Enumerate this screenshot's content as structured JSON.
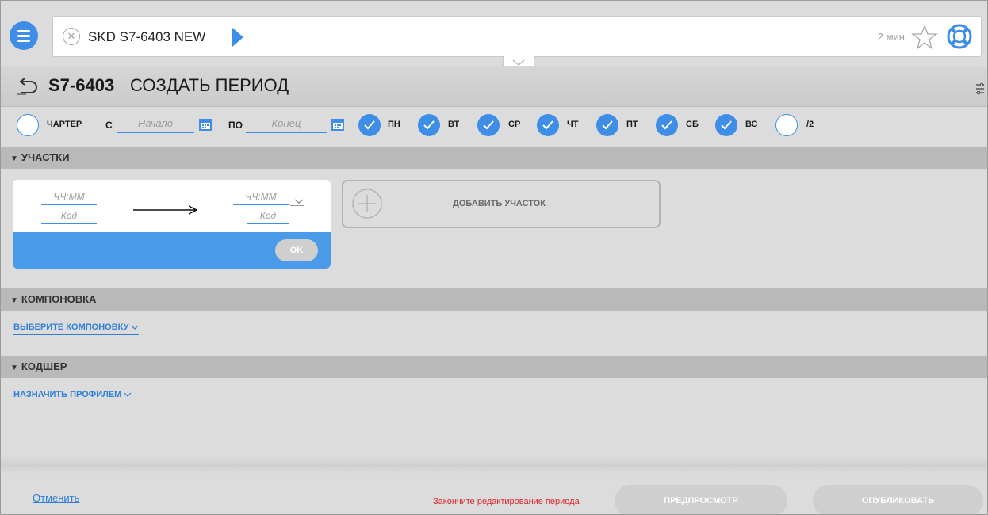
{
  "header": {
    "tab_title": "SKD S7-6403 NEW",
    "time_ago": "2 мин"
  },
  "title_row": {
    "flight_code": "S7-6403",
    "page_title": "СОЗДАТЬ ПЕРИОД"
  },
  "period": {
    "charter_label": "ЧАРТЕР",
    "from_label": "С",
    "from_placeholder": "Начало",
    "to_label": "ПО",
    "to_placeholder": "Конец",
    "days": [
      {
        "label": "ПН",
        "checked": true
      },
      {
        "label": "ВТ",
        "checked": true
      },
      {
        "label": "СР",
        "checked": true
      },
      {
        "label": "ЧТ",
        "checked": true
      },
      {
        "label": "ПТ",
        "checked": true
      },
      {
        "label": "СБ",
        "checked": true
      },
      {
        "label": "ВС",
        "checked": true
      },
      {
        "label": "/2",
        "checked": false
      }
    ]
  },
  "sections": {
    "segments": "УЧАСТКИ",
    "layout": "КОМПОНОВКА",
    "codeshare": "КОДШЕР"
  },
  "segment_card": {
    "dep_time_placeholder": "ЧЧ:ММ",
    "dep_code_placeholder": "Код",
    "arr_time_placeholder": "ЧЧ:ММ",
    "arr_code_placeholder": "Код",
    "ok_label": "OK"
  },
  "add_segment_label": "ДОБАВИТЬ УЧАСТОК",
  "layout_dropdown": "ВЫБЕРИТЕ КОМПОНОВКУ",
  "codeshare_dropdown": "НАЗНАЧИТЬ ПРОФИЛЕМ",
  "footer": {
    "cancel": "Отменить",
    "warning": "Закончите редактирование периода",
    "preview": "ПРЕДПРОСМОТР",
    "publish": "ОПУБЛИКОВАТЬ"
  },
  "colors": {
    "accent": "#3e8ee8",
    "warning": "#e3242b",
    "disabled_button": "#cfcfcf"
  }
}
